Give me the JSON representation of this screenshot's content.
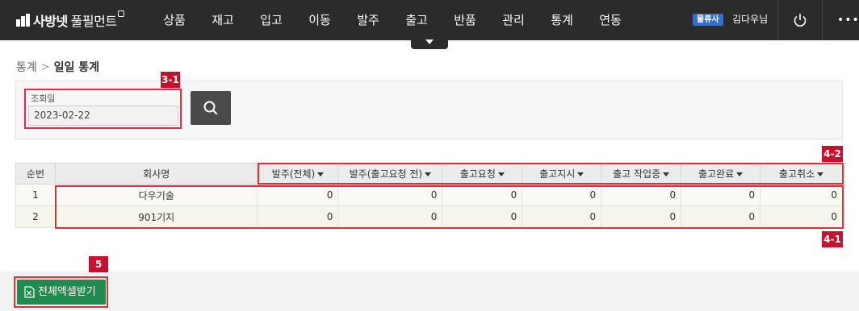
{
  "header": {
    "logo_main": "사방넷",
    "logo_sub": "풀필먼트",
    "nav": [
      "상품",
      "재고",
      "입고",
      "이동",
      "발주",
      "출고",
      "반품",
      "관리",
      "통계",
      "연동"
    ],
    "badge": "물류사",
    "user": "김다우님",
    "icons": {
      "power": "power-icon",
      "more": "more-icon"
    }
  },
  "breadcrumb": {
    "parent": "통계",
    "current": "일일 통계"
  },
  "search": {
    "label": "조회일",
    "value": "2023-02-22",
    "button_icon": "search-icon"
  },
  "markers": {
    "search_field": "3-1",
    "headers": "4-2",
    "rows": "4-1",
    "excel": "5"
  },
  "table": {
    "columns": [
      "순번",
      "회사명",
      "발주(전체)",
      "발주(출고요청 전)",
      "출고요청",
      "출고지시",
      "출고 작업중",
      "출고완료",
      "출고취소"
    ],
    "rows": [
      [
        "1",
        "다우기술",
        "0",
        "0",
        "0",
        "0",
        "0",
        "0",
        "0"
      ],
      [
        "2",
        "901기지",
        "0",
        "0",
        "0",
        "0",
        "0",
        "0",
        "0"
      ]
    ]
  },
  "footer": {
    "excel_button": "전체엑셀받기",
    "excel_icon": "excel-icon"
  },
  "colors": {
    "topbar": "#2b2b2b",
    "accent_red": "#d9323a",
    "badge_blue": "#2f6fd6",
    "excel_green": "#1f8b4c"
  }
}
